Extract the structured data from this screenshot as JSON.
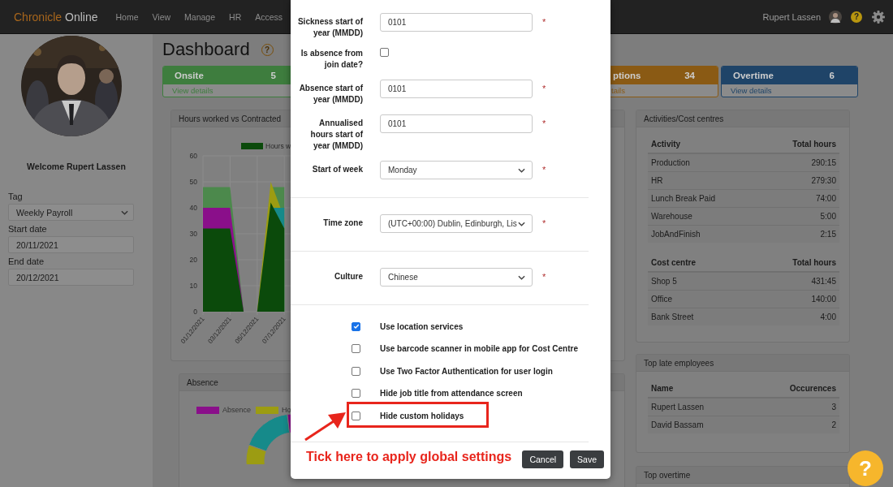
{
  "navbar": {
    "brand_primary": "Chronicle",
    "brand_secondary": "Online",
    "menu": [
      "Home",
      "View",
      "Manage",
      "HR",
      "Access"
    ],
    "user_name": "Rupert Lassen",
    "help": "?"
  },
  "sidebar": {
    "welcome": "Welcome Rupert Lassen",
    "fields": [
      {
        "label": "Tag",
        "kind": "select",
        "value": "Weekly Payroll"
      },
      {
        "label": "Start date",
        "kind": "input",
        "value": "20/11/2021"
      },
      {
        "label": "End date",
        "kind": "input",
        "value": "20/12/2021"
      }
    ]
  },
  "dashboard": {
    "title": "Dashboard",
    "help": "?",
    "cards": [
      {
        "title": "Onsite",
        "count": "5",
        "link": "View details",
        "color": "#3e7d3e"
      },
      {
        "title": "ptions",
        "count": "34",
        "link": "tails",
        "color": "#8a5a14"
      },
      {
        "title": "Overtime",
        "count": "6",
        "link": "View details",
        "color": "#1f4468"
      }
    ]
  },
  "hours_panel": {
    "title": "Hours worked vs Contracted",
    "chart_data": {
      "type": "area",
      "stacked": false,
      "grid": true,
      "categories": [
        "01/12/2021",
        null,
        "03/12/2021",
        null,
        "05/12/2021",
        null,
        "07/12/2021"
      ],
      "ylim": [
        0,
        60
      ],
      "yticks": [
        0,
        10,
        20,
        30,
        40,
        50,
        60
      ],
      "series": [
        {
          "name": "Hours w",
          "color": "#0b4a0b",
          "values": [
            32,
            32,
            32,
            0,
            0,
            42,
            32
          ]
        },
        {
          "color": "#8a0f8a",
          "values": [
            40,
            40,
            40,
            0,
            null,
            null,
            null
          ]
        },
        {
          "color": "#168a8a",
          "values": [
            null,
            null,
            null,
            null,
            null,
            40,
            40
          ]
        },
        {
          "color": "#9c9c12",
          "values": [
            null,
            null,
            null,
            null,
            0,
            50,
            36
          ]
        },
        {
          "color": "#4c894c",
          "values": [
            48,
            48,
            48,
            0,
            0,
            48,
            48
          ]
        }
      ]
    }
  },
  "absence_panel": {
    "title": "Absence",
    "legend": [
      {
        "label": "Absence",
        "color": "#8a0f8a"
      },
      {
        "label": "Ho",
        "color": "#9c9c12"
      }
    ]
  },
  "activities_panel": {
    "title": "Activities/Cost centres",
    "tables": [
      {
        "columns": [
          "Activity",
          "Total hours"
        ],
        "rows": [
          [
            "Production",
            "290:15"
          ],
          [
            "HR",
            "279:30"
          ],
          [
            "Lunch Break Paid",
            "74:00"
          ],
          [
            "Warehouse",
            "5:00"
          ],
          [
            "JobAndFinish",
            "2:15"
          ]
        ]
      },
      {
        "columns": [
          "Cost centre",
          "Total hours"
        ],
        "rows": [
          [
            "Shop 5",
            "431:45"
          ],
          [
            "Office",
            "140:00"
          ],
          [
            "Bank Street",
            "4:00"
          ]
        ]
      }
    ]
  },
  "late_panel": {
    "title": "Top late employees",
    "tables": [
      {
        "columns": [
          "Name",
          "Occurences"
        ],
        "rows": [
          [
            "Rupert Lassen",
            "3"
          ],
          [
            "David Bassam",
            "2"
          ]
        ]
      }
    ]
  },
  "overtime_panel": {
    "title": "Top overtime"
  },
  "modal": {
    "sections": [
      [
        {
          "label": "Sickness start of year (MMDD)",
          "kind": "input",
          "value": "0101",
          "required_mark": "*"
        },
        {
          "label": "Is absence from join date?",
          "kind": "checkbox",
          "checked": false
        },
        {
          "label": "Absence start of year (MMDD)",
          "kind": "input",
          "value": "0101",
          "required_mark": "*"
        },
        {
          "label": "Annualised hours start of year (MMDD)",
          "kind": "input",
          "value": "0101",
          "required_mark": "*"
        },
        {
          "label": "Start of week",
          "kind": "select",
          "value": "Monday",
          "required_mark": "*"
        }
      ],
      [
        {
          "label": "Time zone",
          "kind": "select",
          "value": "(UTC+00:00) Dublin, Edinburgh, Lis",
          "required_mark": "*"
        }
      ],
      [
        {
          "label": "Culture",
          "kind": "select",
          "value": "Chinese",
          "required_mark": "*"
        }
      ]
    ],
    "options": [
      {
        "label": "Use location services",
        "checked": true,
        "highlighted": false
      },
      {
        "label": "Use barcode scanner in mobile app for Cost Centre",
        "checked": false,
        "highlighted": false
      },
      {
        "label": "Use Two Factor Authentication for user login",
        "checked": false,
        "highlighted": false
      },
      {
        "label": "Hide job title from attendance screen",
        "checked": false,
        "highlighted": false
      },
      {
        "label": "Hide custom holidays",
        "checked": false,
        "highlighted": true
      }
    ],
    "annotation": "Tick here to apply global settings",
    "buttons": [
      "Cancel",
      "Save"
    ]
  },
  "help_button": "?"
}
